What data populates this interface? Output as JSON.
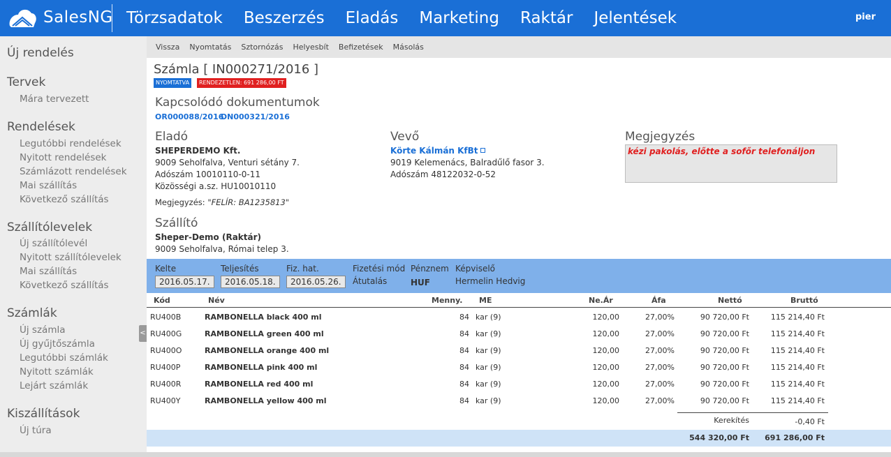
{
  "app": {
    "brand": "SalesNG",
    "user": "pier"
  },
  "nav": [
    "Törzsadatok",
    "Beszerzés",
    "Eladás",
    "Marketing",
    "Raktár",
    "Jelentések"
  ],
  "sidebar": {
    "new_order": "Új rendelés",
    "sections": [
      {
        "title": "Tervek",
        "items": [
          "Mára tervezett"
        ]
      },
      {
        "title": "Rendelések",
        "items": [
          "Legutóbbi rendelések",
          "Nyitott rendelések",
          "Számlázott rendelések",
          "Mai szállítás",
          "Következő szállítás"
        ]
      },
      {
        "title": "Szállítólevelek",
        "items": [
          "Új szállítólevél",
          "Nyitott szállítólevelek",
          "Mai szállítás",
          "Következő szállítás"
        ]
      },
      {
        "title": "Számlák",
        "items": [
          "Új számla",
          "Új gyűjtőszámla",
          "Legutóbbi számlák",
          "Nyitott számlák",
          "Lejárt számlák"
        ]
      },
      {
        "title": "Kiszállítások",
        "items": [
          "Új túra"
        ]
      }
    ],
    "collapse": "<"
  },
  "toolbar": [
    "Vissza",
    "Nyomtatás",
    "Sztornózás",
    "Helyesbít",
    "Befizetések",
    "Másolás"
  ],
  "invoice": {
    "title": "Számla [ IN000271/2016 ]",
    "badge_printed": "NYOMTATVA",
    "badge_unsettled": "RENDEZETLEN: 691 286,00 FT",
    "related_title": "Kapcsolódó dokumentumok",
    "related": [
      "OR000088/2016",
      "DN000321/2016"
    ]
  },
  "seller": {
    "title": "Eladó",
    "name": "SHEPERDEMO Kft.",
    "address": "9009 Seholfalva, Venturi sétány 7.",
    "tax": "Adószám 10010110-0-11",
    "eu_tax": "Közösségi a.sz. HU10010110",
    "note_label": "Megjegyzés:",
    "note_value": "\"FELÍR: BA1235813\""
  },
  "buyer": {
    "title": "Vevő",
    "name": "Körte Kálmán KfBt",
    "address": "9019 Kelemenács, Balradűlő fasor 3.",
    "tax": "Adószám 48122032-0-52"
  },
  "remark": {
    "title": "Megjegyzés",
    "value": "kézi pakolás, előtte a sofőr telefonáljon"
  },
  "carrier": {
    "title": "Szállító",
    "name": "Sheper-Demo (Raktár)",
    "address": "9009 Seholfalva, Római telep 3."
  },
  "dates": {
    "issue_label": "Kelte",
    "issue": "2016.05.17.",
    "fulfil_label": "Teljesítés",
    "fulfil": "2016.05.18.",
    "due_label": "Fiz. hat.",
    "due": "2016.05.26.",
    "payment_label": "Fizetési mód",
    "payment": "Átutalás",
    "currency_label": "Pénznem",
    "currency": "HUF",
    "agent_label": "Képviselő",
    "agent": "Hermelin Hedvig"
  },
  "table": {
    "headers": {
      "code": "Kód",
      "name": "Név",
      "qty": "Menny.",
      "unit": "ME",
      "price": "Ne.Ár",
      "vat": "Áfa",
      "net": "Nettó",
      "gross": "Bruttó"
    },
    "rows": [
      {
        "code": "RU400B",
        "name": "RAMBONELLA black 400 ml",
        "qty": "84",
        "unit": "kar (9)",
        "price": "120,00",
        "vat": "27,00%",
        "net": "90 720,00 Ft",
        "gross": "115 214,40 Ft"
      },
      {
        "code": "RU400G",
        "name": "RAMBONELLA green 400 ml",
        "qty": "84",
        "unit": "kar (9)",
        "price": "120,00",
        "vat": "27,00%",
        "net": "90 720,00 Ft",
        "gross": "115 214,40 Ft"
      },
      {
        "code": "RU400O",
        "name": "RAMBONELLA orange 400 ml",
        "qty": "84",
        "unit": "kar (9)",
        "price": "120,00",
        "vat": "27,00%",
        "net": "90 720,00 Ft",
        "gross": "115 214,40 Ft"
      },
      {
        "code": "RU400P",
        "name": "RAMBONELLA pink 400 ml",
        "qty": "84",
        "unit": "kar (9)",
        "price": "120,00",
        "vat": "27,00%",
        "net": "90 720,00 Ft",
        "gross": "115 214,40 Ft"
      },
      {
        "code": "RU400R",
        "name": "RAMBONELLA red 400 ml",
        "qty": "84",
        "unit": "kar (9)",
        "price": "120,00",
        "vat": "27,00%",
        "net": "90 720,00 Ft",
        "gross": "115 214,40 Ft"
      },
      {
        "code": "RU400Y",
        "name": "RAMBONELLA yellow 400 ml",
        "qty": "84",
        "unit": "kar (9)",
        "price": "120,00",
        "vat": "27,00%",
        "net": "90 720,00 Ft",
        "gross": "115 214,40 Ft"
      }
    ],
    "rounding_label": "Kerekítés",
    "rounding_value": "-0,40 Ft",
    "total_net": "544 320,00 Ft",
    "total_gross": "691 286,00 Ft"
  },
  "colors": {
    "primary": "#1a6fd6",
    "danger": "#e02020",
    "datebar": "#7fb0ea",
    "totalbar": "#cfe3f7"
  },
  "icons": {
    "logo": "cloud-logo-icon",
    "external": "external-link-icon"
  }
}
